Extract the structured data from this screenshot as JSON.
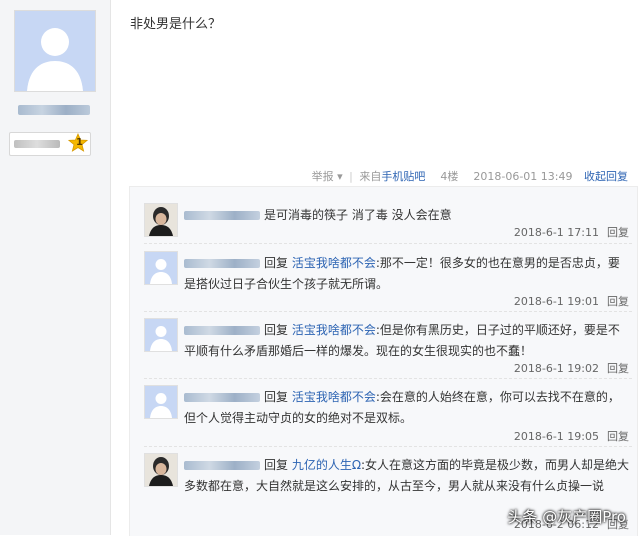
{
  "post": {
    "text": "非处男是什么？",
    "meta": {
      "report": "举报 ▾",
      "source_prefix": "来自",
      "source_link": "手机贴吧",
      "floor": "4楼",
      "datetime": "2018-06-01 13:49",
      "collapse": "收起回复"
    }
  },
  "author": {
    "level": "1"
  },
  "replies": [
    {
      "prefix": "",
      "target": "",
      "text": "是可消毒的筷子 消了毒 没人会在意",
      "time": "2018-6-1 17:11",
      "reply_label": "回复"
    },
    {
      "prefix": "回复 ",
      "target": "活宝我啥都不会",
      "text": ":那不一定！很多女的也在意男的是否忠贞，要是搭伙过日子合伙生个孩子就无所谓。",
      "time": "2018-6-1 19:01",
      "reply_label": "回复"
    },
    {
      "prefix": "回复 ",
      "target": "活宝我啥都不会",
      "text": ":但是你有黑历史，日子过的平顺还好，要是不平顺有什么矛盾那婚后一样的爆发。现在的女生很现实的也不蠢！",
      "time": "2018-6-1 19:02",
      "reply_label": "回复"
    },
    {
      "prefix": "回复 ",
      "target": "活宝我啥都不会",
      "text": ":会在意的人始终在意，你可以去找不在意的，但个人觉得主动守贞的女的绝对不是双标。",
      "time": "2018-6-1 19:05",
      "reply_label": "回复"
    },
    {
      "prefix": "回复 ",
      "target": "九亿的人生Ω",
      "text": ":女人在意这方面的毕竟是极少数，而男人却是绝大多数都在意，大自然就是这么安排的，从古至今，男人就从来没有什么贞操一说",
      "time": "2018-6-2 06:12",
      "reply_label": "回复"
    }
  ],
  "watermark": "头条 @灰产圈Pro",
  "colors": {
    "link": "#2d64b3",
    "panel_bg": "#f7f8fa",
    "sidebar_bg": "#f4f5f7"
  }
}
